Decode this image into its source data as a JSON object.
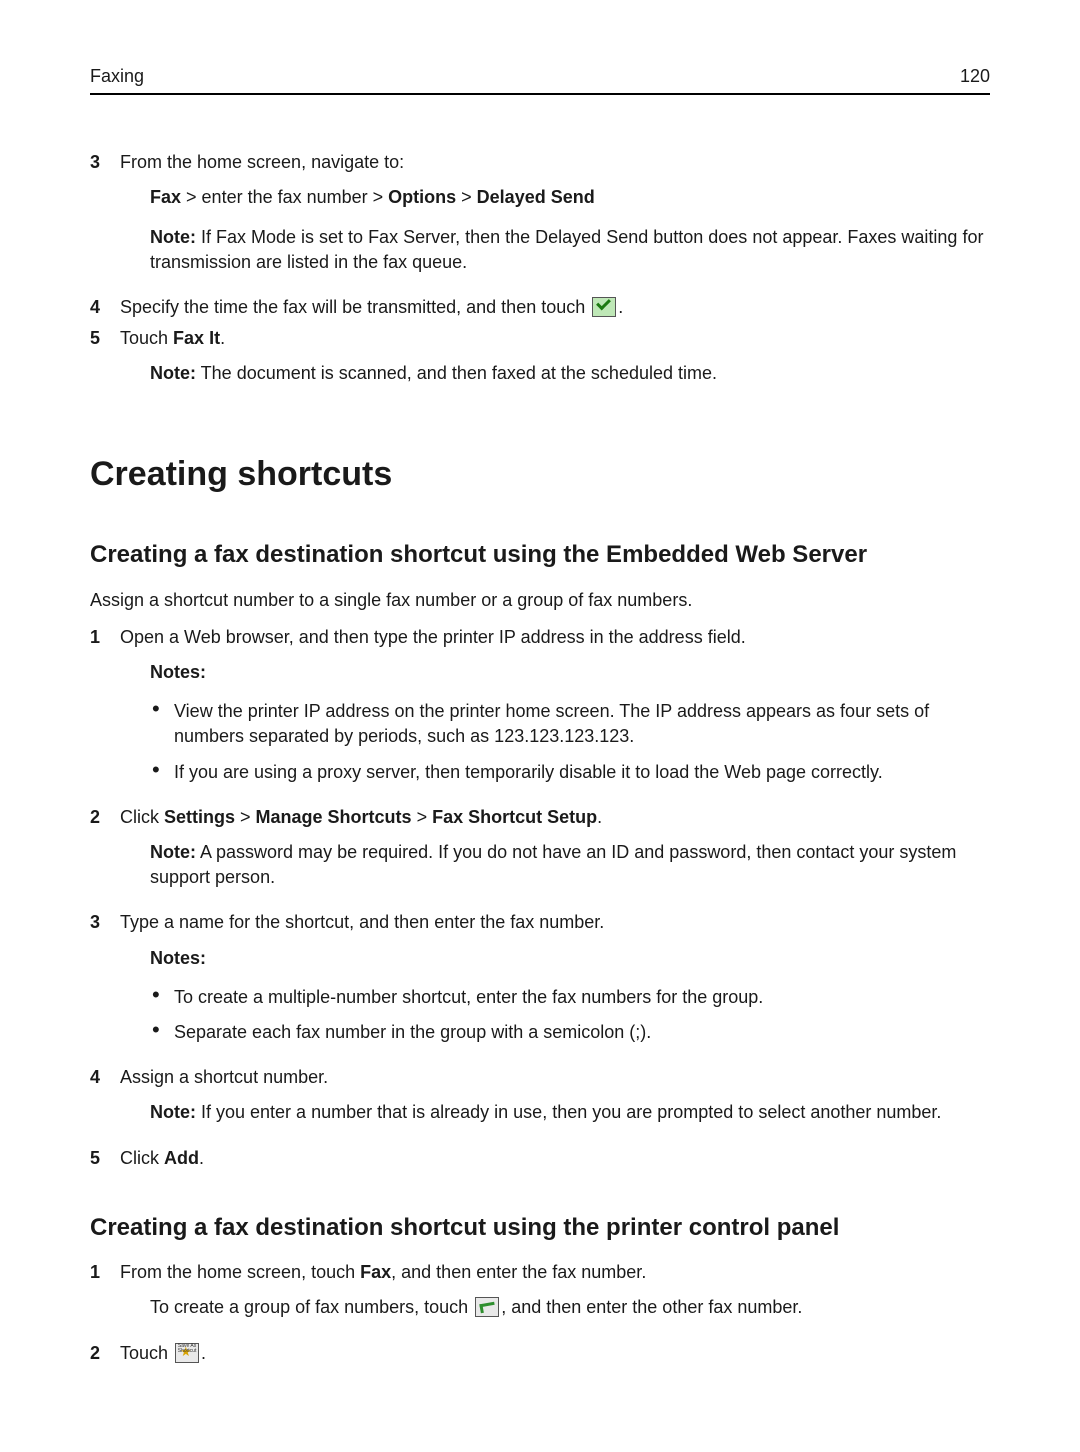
{
  "header": {
    "left": "Faxing",
    "page_number": "120"
  },
  "top_steps": {
    "s3": {
      "num": "3",
      "text": "From the home screen, navigate to:",
      "breadcrumb_fax": "Fax",
      "breadcrumb_mid": " > enter the fax number > ",
      "breadcrumb_options": "Options",
      "breadcrumb_gt": " > ",
      "breadcrumb_delayed": "Delayed Send",
      "note_label": "Note:",
      "note_text": " If Fax Mode is set to Fax Server, then the Delayed Send button does not appear. Faxes waiting for transmission are listed in the fax queue."
    },
    "s4": {
      "num": "4",
      "text_before": "Specify the time the fax will be transmitted, and then touch ",
      "text_after": "."
    },
    "s5": {
      "num": "5",
      "text_before": "Touch ",
      "bold": "Fax It",
      "text_after": ".",
      "note_label": "Note:",
      "note_text": " The document is scanned, and then faxed at the scheduled time."
    }
  },
  "h1": "Creating shortcuts",
  "sectionA": {
    "title": "Creating a fax destination shortcut using the Embedded Web Server",
    "intro": "Assign a shortcut number to a single fax number or a group of fax numbers.",
    "s1": {
      "num": "1",
      "text": "Open a Web browser, and then type the printer IP address in the address field.",
      "notes_label": "Notes:",
      "b1": "View the printer IP address on the printer home screen. The IP address appears as four sets of numbers separated by periods, such as 123.123.123.123.",
      "b2": "If you are using a proxy server, then temporarily disable it to load the Web page correctly."
    },
    "s2": {
      "num": "2",
      "text_before": "Click ",
      "b1": "Settings",
      "gt1": " > ",
      "b2": "Manage Shortcuts",
      "gt2": " > ",
      "b3": "Fax Shortcut Setup",
      "text_after": ".",
      "note_label": "Note:",
      "note_text": " A password may be required. If you do not have an ID and password, then contact your system support person."
    },
    "s3": {
      "num": "3",
      "text": "Type a name for the shortcut, and then enter the fax number.",
      "notes_label": "Notes:",
      "b1": "To create a multiple‑number shortcut, enter the fax numbers for the group.",
      "b2": "Separate each fax number in the group with a semicolon (;)."
    },
    "s4": {
      "num": "4",
      "text": "Assign a shortcut number.",
      "note_label": "Note:",
      "note_text": " If you enter a number that is already in use, then you are prompted to select another number."
    },
    "s5": {
      "num": "5",
      "text_before": "Click ",
      "bold": "Add",
      "text_after": "."
    }
  },
  "sectionB": {
    "title": "Creating a fax destination shortcut using the printer control panel",
    "s1": {
      "num": "1",
      "text_before": "From the home screen, touch ",
      "bold": "Fax",
      "text_after": ", and then enter the fax number.",
      "indent_before": "To create a group of fax numbers, touch ",
      "indent_after": ", and then enter the other fax number."
    },
    "s2": {
      "num": "2",
      "text_before": "Touch ",
      "text_after": "."
    }
  }
}
